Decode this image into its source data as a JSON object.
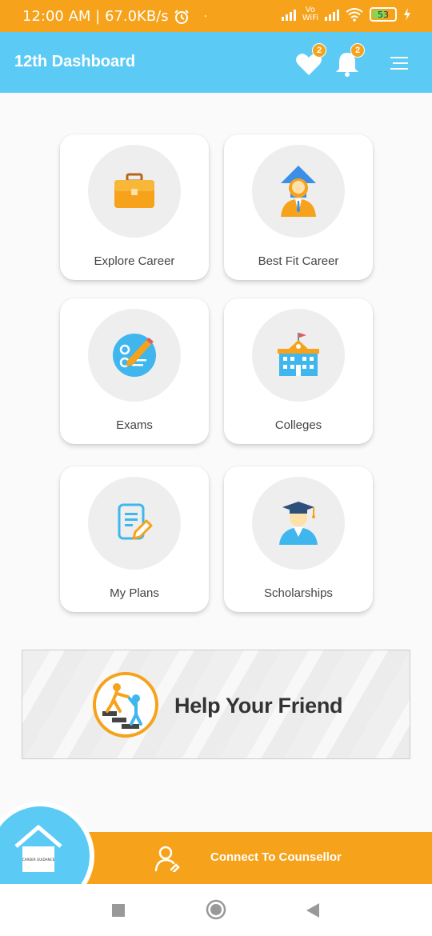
{
  "status_bar": {
    "time_speed": "12:00 AM | 67.0KB/s",
    "vowifi_top": "Vo",
    "vowifi_bottom": "WiFi",
    "battery": "53"
  },
  "app_bar": {
    "title": "12th Dashboard",
    "favorites_badge": "2",
    "notifications_badge": "2"
  },
  "tiles": [
    {
      "label": "Explore Career",
      "icon": "briefcase-icon"
    },
    {
      "label": "Best Fit Career",
      "icon": "career-growth-icon"
    },
    {
      "label": "Exams",
      "icon": "exam-icon"
    },
    {
      "label": "Colleges",
      "icon": "college-building-icon"
    },
    {
      "label": "My Plans",
      "icon": "plan-document-icon"
    },
    {
      "label": "Scholarships",
      "icon": "graduate-icon"
    }
  ],
  "banner": {
    "text": "Help Your Friend"
  },
  "bottom": {
    "connect_label": "Connect To Counsellor",
    "home_caption": "CAREER GUIDANCE"
  },
  "colors": {
    "orange": "#f6a21a",
    "blue": "#5bcbf5"
  }
}
